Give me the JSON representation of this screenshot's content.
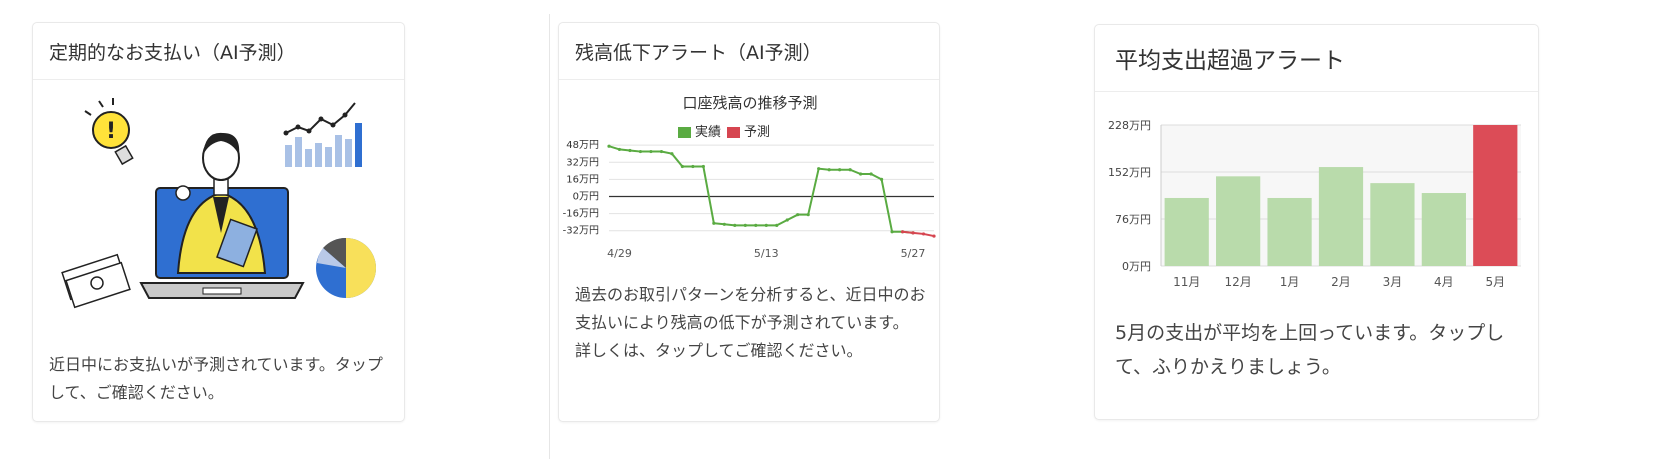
{
  "cards": [
    {
      "title": "定期的なお支払い（AI予測）",
      "description": "近日中にお支払いが予測されています。タップして、ご確認ください。",
      "illustration": "person-laptop-finance-illustration"
    },
    {
      "title": "残高低下アラート（AI予測）",
      "description": "過去のお取引パターンを分析すると、近日中のお支払いにより残高の低下が予測されています。",
      "description2": "詳しくは、タップしてご確認ください。"
    },
    {
      "title": "平均支出超過アラート",
      "description": "5月の支出が平均を上回っています。タップして、ふりかえりましょう。"
    }
  ],
  "colors": {
    "actual": "#5aab42",
    "forecast": "#d64550",
    "bar_normal": "#b9dbab",
    "bar_highlight": "#dc4c57"
  },
  "chart_data": [
    {
      "type": "line",
      "title": "口座残高の推移予測",
      "legend": [
        "実績",
        "予測"
      ],
      "legend_position": "top",
      "y_unit": "万円",
      "yticks": [
        "48万円",
        "32万円",
        "16万円",
        "0万円",
        "-16万円",
        "-32万円"
      ],
      "ytick_values": [
        48,
        32,
        16,
        0,
        -16,
        -32
      ],
      "ylim": [
        -36,
        50
      ],
      "xticks": [
        "4/29",
        "5/13",
        "5/27"
      ],
      "xtick_values": [
        1,
        15,
        29
      ],
      "grid": true,
      "series": [
        {
          "name": "実績",
          "x": [
            0,
            1,
            2,
            3,
            4,
            5,
            6,
            7,
            8,
            9,
            10,
            11,
            12,
            13,
            14,
            15,
            16,
            17,
            18,
            19,
            20,
            21,
            22,
            23,
            24,
            25,
            26,
            27,
            28,
            29
          ],
          "y": [
            47,
            44,
            43,
            42,
            42,
            42,
            40,
            28,
            28,
            28,
            -25,
            -26,
            -27,
            -27,
            -27,
            -27,
            -27,
            -22,
            -17,
            -17,
            26,
            25,
            25,
            25,
            21,
            21,
            16,
            -33,
            -33,
            -34
          ]
        },
        {
          "name": "予測",
          "x": [
            28,
            29,
            30,
            31
          ],
          "y": [
            -33,
            -34,
            -35,
            -37
          ]
        }
      ]
    },
    {
      "type": "bar",
      "y_unit": "万円",
      "yticks": [
        "228万円",
        "152万円",
        "76万円",
        "0万円"
      ],
      "ytick_values": [
        228,
        152,
        76,
        0
      ],
      "ylim": [
        0,
        228
      ],
      "categories": [
        "11月",
        "12月",
        "1月",
        "2月",
        "3月",
        "4月",
        "5月"
      ],
      "values": [
        110,
        145,
        110,
        160,
        134,
        118,
        228
      ],
      "highlight_index": 6,
      "grid": true
    }
  ]
}
